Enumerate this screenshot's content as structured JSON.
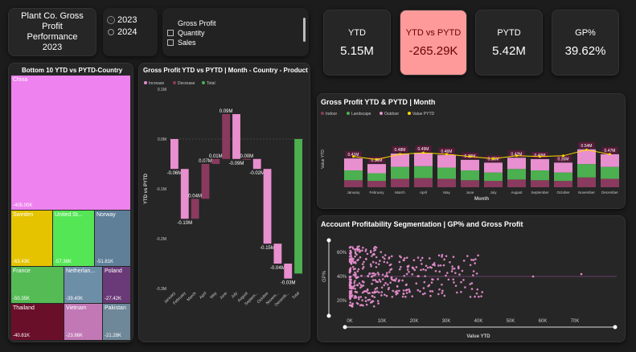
{
  "header": {
    "title": "Plant Co. Gross Profit Performance 2023",
    "years": [
      "2023",
      "2024"
    ],
    "selected_year": "2023",
    "metrics": [
      "Gross Profit",
      "Quantity",
      "Sales"
    ]
  },
  "kpis": [
    {
      "label": "YTD",
      "value": "5.15M"
    },
    {
      "label": "YTD vs PYTD",
      "value": "-265.29K"
    },
    {
      "label": "PYTD",
      "value": "5.42M"
    },
    {
      "label": "GP%",
      "value": "39.62%"
    }
  ],
  "colors": {
    "pink": "#e88fcf",
    "highlight": "#ff9a9a",
    "green": "#4caf50",
    "maroon": "#8a3a5e"
  },
  "treemap": {
    "title": "Bottom 10 YTD vs PYTD-Country",
    "tiles": [
      {
        "name": "China",
        "value": "-405.00K",
        "color": "#ee82ee"
      },
      {
        "name": "Sweden",
        "value": "-63.43K",
        "color": "#e5c300"
      },
      {
        "name": "United St...",
        "value": "-57.38K",
        "color": "#55e655"
      },
      {
        "name": "Norway",
        "value": "-51.81K",
        "color": "#5f7f99"
      },
      {
        "name": "France",
        "value": "-50.35K",
        "color": "#55bb55"
      },
      {
        "name": "Netherlan...",
        "value": "-39.40K",
        "color": "#6d8ea7"
      },
      {
        "name": "Poland",
        "value": "-27.42K",
        "color": "#6a3a78"
      },
      {
        "name": "Thailand",
        "value": "-40.81K",
        "color": "#6a0f2a"
      },
      {
        "name": "Vietnam",
        "value": "-23.86K",
        "color": "#c178b5"
      },
      {
        "name": "Pakistan",
        "value": "-21.28K",
        "color": "#6e8799"
      }
    ]
  },
  "waterfall": {
    "title": "Gross Profit YTD vs PYTD | Month - Country - Product",
    "legend": [
      "Increase",
      "Decrease",
      "Total"
    ],
    "ylabel": "YTD vs PYTD",
    "yticks": [
      "0.1M",
      "0.0M",
      "-0.1M",
      "-0.2M",
      "-0.3M"
    ],
    "categories": [
      "January",
      "February",
      "March",
      "April",
      "May",
      "June",
      "July",
      "August",
      "Septem...",
      "October",
      "Novem...",
      "Decemb...",
      "Total"
    ],
    "labels": [
      "-0.06M",
      "-0.10M",
      "0.04M",
      "0.07M",
      "0.01M",
      "0.09M",
      "-0.09M",
      "0.00M",
      "-0.02M",
      "-0.15M",
      "-0.04M",
      "-0.03M",
      ""
    ]
  },
  "combo": {
    "title": "Gross Profit YTD & PYTD | Month",
    "legend": [
      "Indoor",
      "Landscape",
      "Outdoor",
      "Value PYTD"
    ],
    "ylabel": "Value YTD",
    "xlabel": "Month",
    "months": [
      "January",
      "February",
      "March",
      "April",
      "May",
      "June",
      "July",
      "August",
      "September",
      "October",
      "November",
      "December"
    ],
    "top_labels": [
      "0.41M",
      "0.33M",
      "0.48M",
      "0.49M",
      "0.46M",
      "0.39M",
      "0.35M",
      "0.42M",
      "0.40M",
      "0.35M",
      "0.54M",
      "0.47M"
    ],
    "pytd_labels": [
      "0.41M",
      "0.37M",
      "0.44M",
      "0.46M",
      "0.44M",
      "0.41M",
      "0.38M",
      "0.42M",
      "0.41M",
      "0.42M",
      "0.50M",
      "0.44M"
    ]
  },
  "scatter": {
    "title": "Account Profitability Segmentation | GP% and Gross Profit",
    "ylabel": "GP%",
    "xlabel": "Value YTD",
    "yticks": [
      "60%",
      "40%",
      "20%"
    ],
    "xticks": [
      "0K",
      "10K",
      "20K",
      "30K",
      "40K",
      "50K",
      "60K",
      "70K"
    ]
  },
  "chart_data": [
    {
      "type": "bar",
      "title": "Gross Profit YTD vs PYTD | Month - Country - Product",
      "categories": [
        "January",
        "February",
        "March",
        "April",
        "May",
        "June",
        "July",
        "August",
        "September",
        "October",
        "November",
        "December",
        "Total"
      ],
      "values": [
        -0.06,
        -0.1,
        0.04,
        0.07,
        0.01,
        0.09,
        -0.09,
        0.0,
        -0.02,
        -0.15,
        -0.04,
        -0.03,
        -0.27
      ],
      "ylabel": "YTD vs PYTD",
      "ylim": [
        -0.3,
        0.1
      ]
    },
    {
      "type": "bar",
      "title": "Gross Profit YTD & PYTD | Month",
      "categories": [
        "January",
        "February",
        "March",
        "April",
        "May",
        "June",
        "July",
        "August",
        "September",
        "October",
        "November",
        "December"
      ],
      "series": [
        {
          "name": "Indoor",
          "values": [
            0.1,
            0.09,
            0.12,
            0.13,
            0.12,
            0.1,
            0.09,
            0.11,
            0.1,
            0.09,
            0.14,
            0.12
          ]
        },
        {
          "name": "Landscape",
          "values": [
            0.14,
            0.11,
            0.17,
            0.17,
            0.16,
            0.14,
            0.12,
            0.15,
            0.14,
            0.12,
            0.19,
            0.17
          ]
        },
        {
          "name": "Outdoor",
          "values": [
            0.17,
            0.13,
            0.19,
            0.19,
            0.18,
            0.15,
            0.14,
            0.16,
            0.16,
            0.14,
            0.21,
            0.18
          ]
        },
        {
          "name": "Value PYTD",
          "values": [
            0.41,
            0.37,
            0.44,
            0.46,
            0.44,
            0.41,
            0.38,
            0.42,
            0.41,
            0.42,
            0.5,
            0.44
          ]
        }
      ],
      "ylabel": "Value YTD",
      "xlabel": "Month"
    }
  ]
}
